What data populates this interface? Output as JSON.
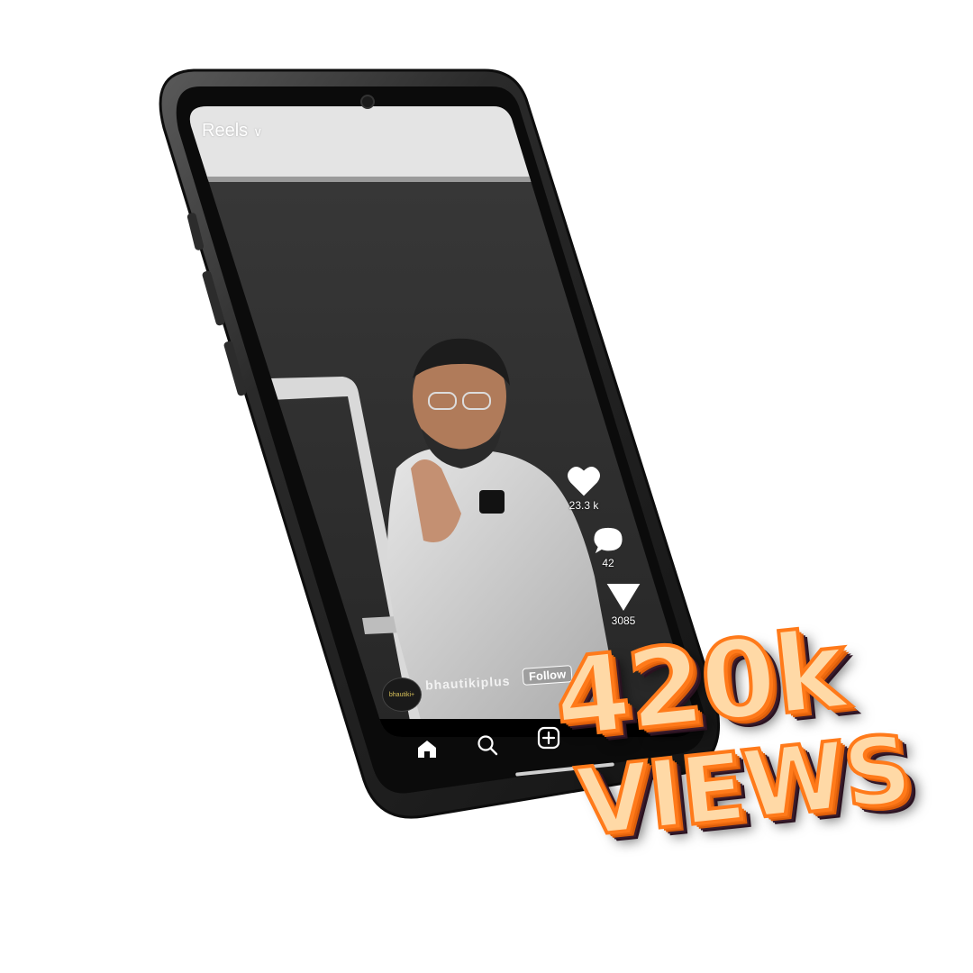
{
  "screen": {
    "header_title": "Reels",
    "header_chevron": "chevron-down-icon"
  },
  "actions": {
    "likes": {
      "icon": "heart-icon",
      "count": "23.3 k"
    },
    "comments": {
      "icon": "comment-icon",
      "count": "42"
    },
    "shares": {
      "icon": "send-icon",
      "count": "3085"
    }
  },
  "post": {
    "avatar_text": "bhautiki+",
    "username": "bhautikiplus",
    "follow_label": "Follow"
  },
  "bottom_nav": {
    "items": [
      "home-icon",
      "search-icon",
      "create-icon"
    ]
  },
  "promo": {
    "number": "420k",
    "label": "VIEWS"
  },
  "colors": {
    "phone_frame": "#1e1e1e",
    "screen_background": "#2f2f2f",
    "promo_fill": "#ffd9a6",
    "promo_outline": "#ff7a1a",
    "promo_shadow": "#2a1220"
  }
}
